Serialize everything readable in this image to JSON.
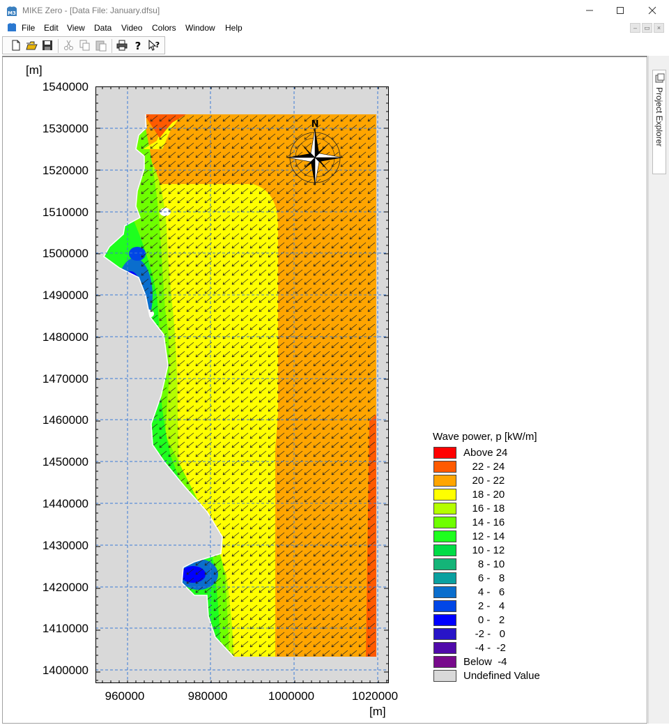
{
  "window": {
    "title": "MIKE Zero - [Data File: January.dfsu]",
    "app_badge": "M3",
    "controls": [
      "minimize",
      "maximize",
      "close"
    ]
  },
  "menu": {
    "items": [
      "File",
      "Edit",
      "View",
      "Data",
      "Video",
      "Colors",
      "Window",
      "Help"
    ]
  },
  "toolbar": {
    "buttons": [
      "new-icon",
      "open-icon",
      "save-icon",
      "cut-icon",
      "copy-icon",
      "paste-icon",
      "print-icon",
      "help-icon",
      "context-help-icon"
    ]
  },
  "project_explorer": {
    "label": "Project Explorer"
  },
  "plot": {
    "y_unit": "[m]",
    "x_unit": "[m]",
    "y_ticks": [
      "1540000",
      "1530000",
      "1520000",
      "1510000",
      "1500000",
      "1490000",
      "1480000",
      "1470000",
      "1460000",
      "1450000",
      "1440000",
      "1430000",
      "1420000",
      "1410000",
      "1400000"
    ],
    "x_ticks": [
      "960000",
      "980000",
      "1000000",
      "1020000"
    ],
    "compass_label": "N",
    "vector_direction": "south-west"
  },
  "legend": {
    "title": "Wave power, p [kW/m]",
    "items": [
      {
        "label": "Above 24",
        "color": "#ff0000"
      },
      {
        "label": "   22 - 24",
        "color": "#ff5a00"
      },
      {
        "label": "   20 - 22",
        "color": "#ffa500"
      },
      {
        "label": "   18 - 20",
        "color": "#ffff00"
      },
      {
        "label": "   16 - 18",
        "color": "#b4ff00"
      },
      {
        "label": "   14 - 16",
        "color": "#6eff00"
      },
      {
        "label": "   12 - 14",
        "color": "#1eff1e"
      },
      {
        "label": "   10 - 12",
        "color": "#00dc46"
      },
      {
        "label": "     8 - 10",
        "color": "#14b478"
      },
      {
        "label": "     6 -   8",
        "color": "#0aa0a0"
      },
      {
        "label": "     4 -   6",
        "color": "#0a6ecd"
      },
      {
        "label": "     2 -   4",
        "color": "#0046e6"
      },
      {
        "label": "     0 -   2",
        "color": "#0000ff"
      },
      {
        "label": "    -2 -   0",
        "color": "#2814c8"
      },
      {
        "label": "    -4 -  -2",
        "color": "#500aaa"
      },
      {
        "label": "Below  -4",
        "color": "#780a8c"
      },
      {
        "label": "Undefined Value",
        "color": "#d9d9d9"
      }
    ]
  }
}
